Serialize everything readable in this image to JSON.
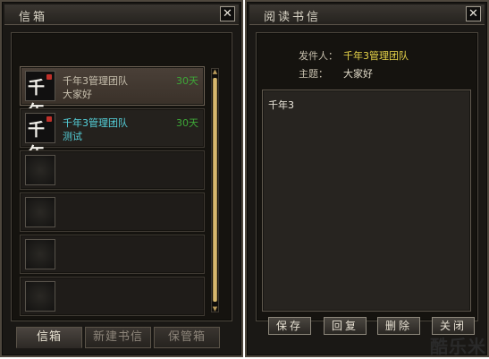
{
  "inbox": {
    "title": "信箱",
    "close_label": "✕",
    "mails": [
      {
        "from": "千年3管理团队",
        "subject": "大家好",
        "days": "30天",
        "avatar_text": "千年",
        "selected": true
      },
      {
        "from": "千年3管理团队",
        "subject": "测试",
        "days": "30天",
        "avatar_text": "千年",
        "selected": false
      }
    ],
    "empty_slots": 4,
    "tabs": [
      "信箱",
      "新建书信",
      "保管箱"
    ],
    "active_tab": 0
  },
  "reader": {
    "title": "阅读书信",
    "close_label": "✕",
    "sender_label": "发件人：",
    "sender_value": "千年3管理团队",
    "subject_label": "主题：",
    "subject_value": "大家好",
    "body": "千年3",
    "buttons": [
      "保存",
      "回复",
      "删除",
      "关闭"
    ]
  },
  "watermark": "酷乐米",
  "colors": {
    "sender_yellow": "#e8d54a",
    "unread_cyan": "#55d2dc",
    "days_green": "#3ea838",
    "scroll_gold": "#e8c97a"
  }
}
